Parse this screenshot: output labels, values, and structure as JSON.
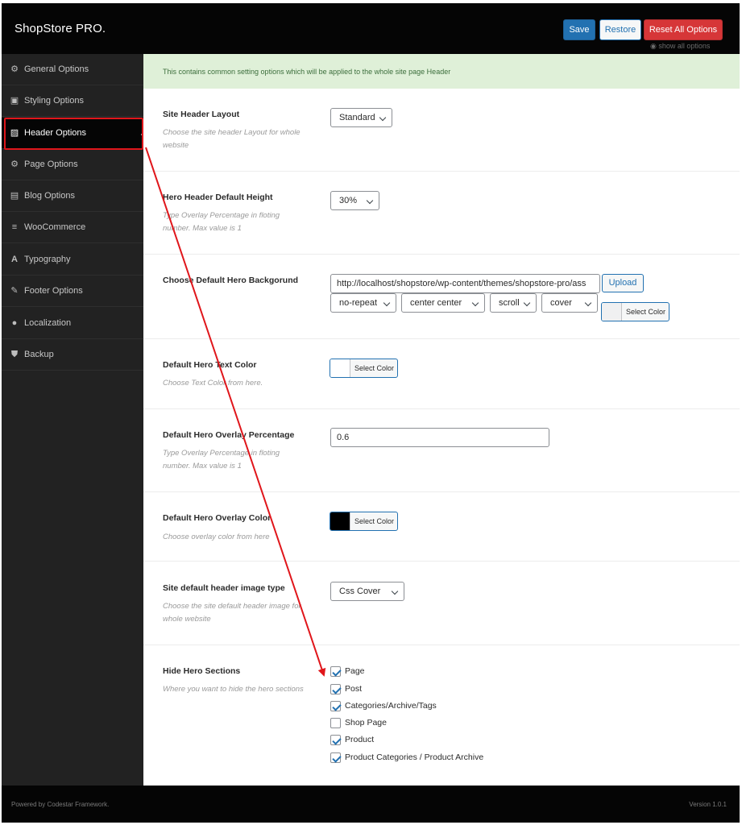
{
  "app": {
    "brand": "ShopStore PRO."
  },
  "toolbar": {
    "save_label": "Save",
    "restore_label": "Restore",
    "reset_label": "Reset All Options",
    "show_all_label": "show all options"
  },
  "sidebar": {
    "items": [
      {
        "label": "General Options",
        "icon": "gears-icon",
        "glyph": "⚙"
      },
      {
        "label": "Styling Options",
        "icon": "frame-icon",
        "glyph": "▣"
      },
      {
        "label": "Header Options",
        "icon": "image-icon",
        "glyph": "▨",
        "active": true
      },
      {
        "label": "Page Options",
        "icon": "gears-icon",
        "glyph": "⚙"
      },
      {
        "label": "Blog Options",
        "icon": "newspaper-icon",
        "glyph": "▤"
      },
      {
        "label": "WooCommerce",
        "icon": "list-icon",
        "glyph": "≡"
      },
      {
        "label": "Typography",
        "icon": "font-icon",
        "glyph": "A"
      },
      {
        "label": "Footer Options",
        "icon": "edit-icon",
        "glyph": "✎"
      },
      {
        "label": "Localization",
        "icon": "globe-icon",
        "glyph": "●"
      },
      {
        "label": "Backup",
        "icon": "shield-icon",
        "glyph": "⛊"
      }
    ]
  },
  "notice": "This contains common setting options which will be applied to the whole site page Header",
  "fields": {
    "layout": {
      "title": "Site Header Layout",
      "desc": "Choose the site header Layout for whole website",
      "value": "Standard"
    },
    "height": {
      "title": "Hero Header Default Height",
      "desc": "Type Overlay Percentage in floting number. Max value is 1",
      "value": "30%"
    },
    "background": {
      "title": "Choose Default Hero Backgorund",
      "url": "http://localhost/shopstore/wp-content/themes/shopstore-pro/ass",
      "upload_label": "Upload",
      "repeat": "no-repeat",
      "position": "center center",
      "attachment": "scroll",
      "size": "cover",
      "color_label": "Select Color",
      "color": "#f6f7f7"
    },
    "text_color": {
      "title": "Default Hero Text Color",
      "desc": "Choose Text Color from here.",
      "color_label": "Select Color",
      "color": "#ffffff"
    },
    "overlay_pct": {
      "title": "Default Hero Overlay Percentage",
      "desc": "Type Overlay Percentage in floting number. Max value is 1",
      "value": "0.6"
    },
    "overlay_color": {
      "title": "Default Hero Overlay Color",
      "desc": "Choose overlay color from here",
      "color_label": "Select Color",
      "color": "#000000"
    },
    "image_type": {
      "title": "Site default header image type",
      "desc": "Choose the site default header image for whole website",
      "value": "Css Cover"
    },
    "hide_hero": {
      "title": "Hide Hero Sections",
      "desc": "Where you want to hide the hero sections",
      "options": [
        {
          "label": "Page",
          "checked": true
        },
        {
          "label": "Post",
          "checked": true
        },
        {
          "label": "Categories/Archive/Tags",
          "checked": true
        },
        {
          "label": "Shop Page",
          "checked": false
        },
        {
          "label": "Product",
          "checked": true
        },
        {
          "label": "Product Categories / Product Archive",
          "checked": true
        }
      ]
    }
  },
  "footer": {
    "powered": "Powered by Codestar Framework.",
    "version": "Version 1.0.1"
  },
  "colors": {
    "accent": "#2271b1",
    "danger": "#d63638",
    "annotation": "#e0161b"
  }
}
